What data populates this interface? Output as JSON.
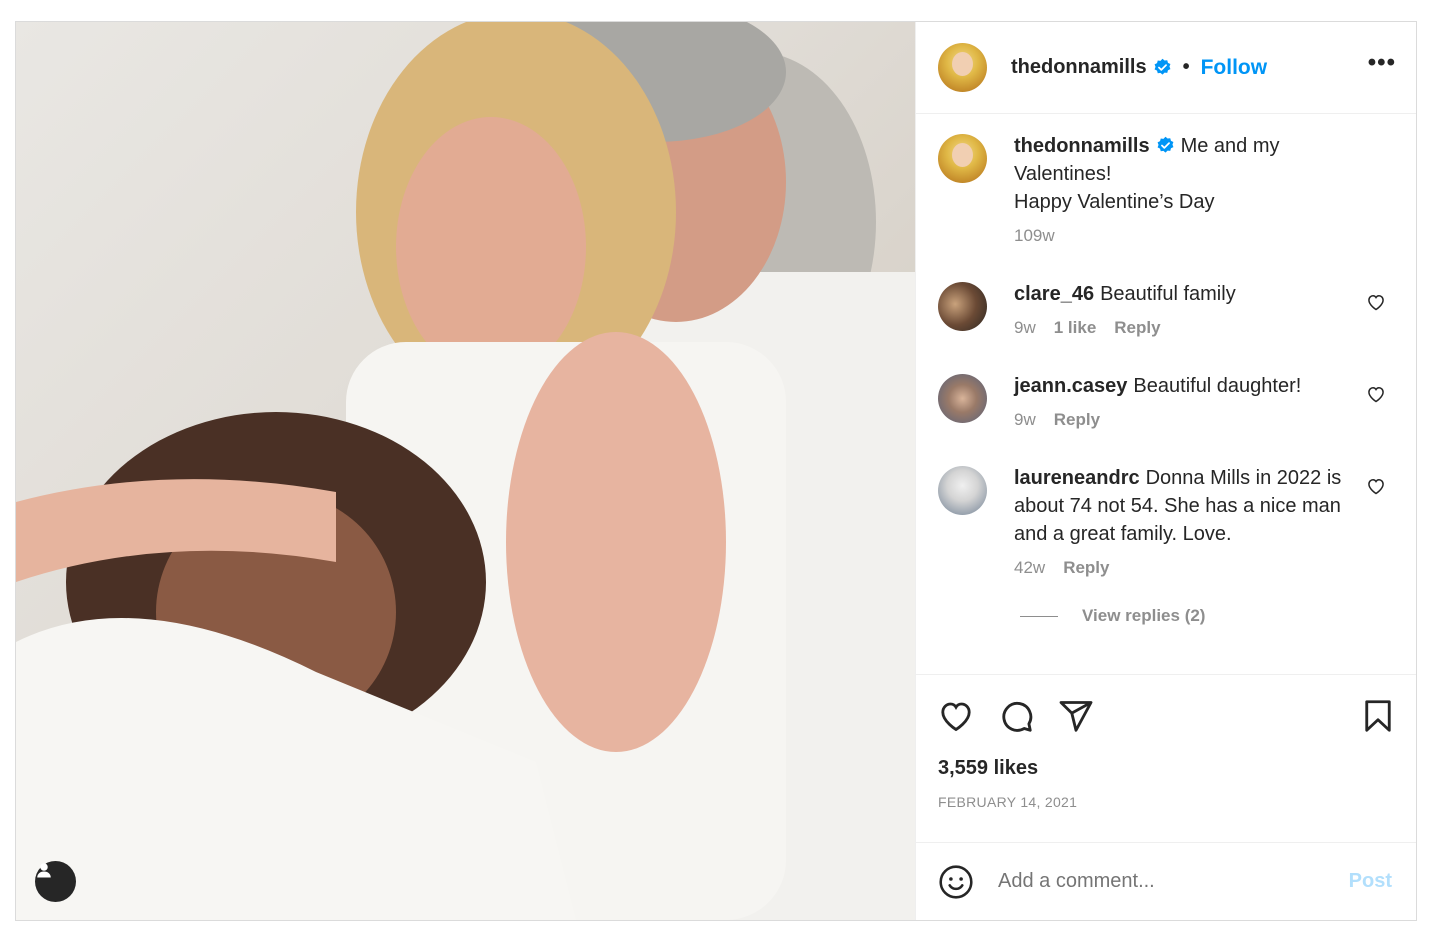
{
  "post": {
    "author": "thedonnamills",
    "follow_label": "Follow",
    "separator": "•",
    "more_label": "•••"
  },
  "caption": {
    "username": "thedonnamills",
    "text": "Me and my Valentines!",
    "text2": "Happy Valentine’s Day",
    "age": "109w"
  },
  "comments": [
    {
      "username": "clare_46",
      "text": "Beautiful family",
      "age": "9w",
      "likes": "1 like",
      "reply": "Reply"
    },
    {
      "username": "jeann.casey",
      "text": "Beautiful daughter!",
      "age": "9w",
      "reply": "Reply"
    },
    {
      "username": "laureneandrc",
      "text": "Donna Mills in 2022 is about 74 not 54. She has a nice man and a great family. Love.",
      "age": "42w",
      "reply": "Reply",
      "view_replies": "View replies (2)"
    }
  ],
  "stats": {
    "likes": "3,559 likes",
    "date": "FEBRUARY 14, 2021"
  },
  "composer": {
    "placeholder": "Add a comment...",
    "post_label": "Post"
  },
  "colors": {
    "accent": "#0095f6",
    "post_disabled": "#b2dffc",
    "muted": "#8e8e8e",
    "text": "#262626"
  }
}
